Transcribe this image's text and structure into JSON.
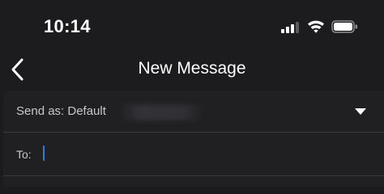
{
  "status_bar": {
    "time": "10:14",
    "icons": [
      "cellular-signal-icon",
      "wifi-icon",
      "battery-icon"
    ]
  },
  "nav": {
    "back_icon": "chevron-left-icon",
    "title": "New Message"
  },
  "send_as": {
    "label": "Send as: Default",
    "dropdown_icon": "triangle-down-icon"
  },
  "to": {
    "label": "To:",
    "value": "",
    "placeholder": ""
  },
  "colors": {
    "background": "#1c1c1e",
    "row_background": "#202022",
    "divider": "#3a3a3c",
    "cursor": "#3478f6",
    "text_primary": "#ffffff",
    "text_secondary": "#c7c7cc"
  }
}
